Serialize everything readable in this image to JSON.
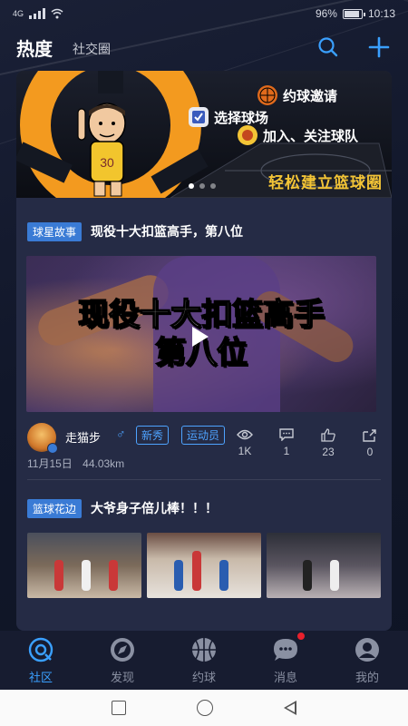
{
  "status": {
    "carrier": "4G",
    "battery": "96%",
    "time": "10:13"
  },
  "header": {
    "active_tab": "热度",
    "other_tab": "社交圈",
    "search_icon": "search-icon",
    "add_icon": "plus-icon"
  },
  "banner": {
    "item1": "约球邀请",
    "item2": "选择球场",
    "item3": "加入、关注球队",
    "slogan": "轻松建立篮球圈"
  },
  "posts": [
    {
      "tag": "球星故事",
      "title": "现役十大扣篮高手，第八位",
      "video_line1": "现役十大扣篮高手",
      "video_line2": "第八位",
      "author": "走猫步",
      "gender": "♂",
      "badge1": "新秀",
      "badge2": "运动员",
      "date": "11月15日",
      "distance": "44.03km",
      "views": "1K",
      "comments": "1",
      "likes": "23",
      "shares": "0"
    },
    {
      "tag": "篮球花边",
      "title": "大爷身子倍儿棒！！！"
    }
  ],
  "nav": {
    "items": [
      {
        "label": "社区",
        "icon": "community-icon",
        "active": true
      },
      {
        "label": "发现",
        "icon": "discover-icon",
        "active": false
      },
      {
        "label": "约球",
        "icon": "basketball-icon",
        "active": false
      },
      {
        "label": "消息",
        "icon": "message-icon",
        "active": false
      },
      {
        "label": "我的",
        "icon": "profile-icon",
        "active": false
      }
    ]
  },
  "colors": {
    "accent": "#3aa0ff",
    "tag": "#3a7bd5",
    "banner_orange": "#f39a1f",
    "slogan": "#f3c436",
    "notify": "#e8202c"
  }
}
